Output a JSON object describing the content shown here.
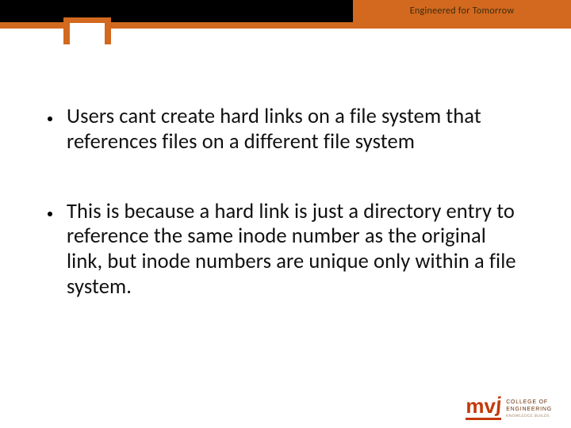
{
  "header": {
    "tagline": "Engineered for Tomorrow"
  },
  "bullets": [
    "Users cant create hard links on a file system that references files on a different file system",
    "This is because a hard link is just a directory entry to reference the same inode number as the original link, but inode numbers are unique only within a file system."
  ],
  "logo": {
    "mark": "mvj",
    "line1": "COLLEGE OF",
    "line2": "ENGINEERING",
    "sub": "KNOWLEDGE BUILDS"
  }
}
